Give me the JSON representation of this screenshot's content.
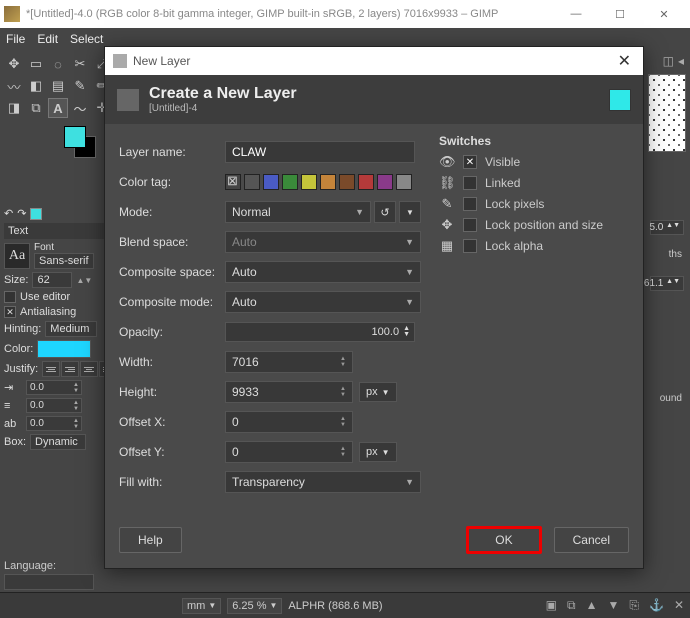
{
  "window": {
    "title": "*[Untitled]-4.0 (RGB color 8-bit gamma integer, GIMP built-in sRGB, 2 layers) 7016x9933 – GIMP"
  },
  "menu": {
    "file": "File",
    "edit": "Edit",
    "select": "Select"
  },
  "left": {
    "text_section": "Text",
    "font_label": "Font",
    "font_value": "Sans-serif",
    "size_label": "Size:",
    "size_value": "62",
    "use_editor": "Use editor",
    "antialiasing": "Antialiasing",
    "hinting_label": "Hinting:",
    "hinting_value": "Medium",
    "color_label": "Color:",
    "justify_label": "Justify:",
    "indent1": "0.0",
    "indent2": "0.0",
    "indent3": "0.0",
    "box_label": "Box:",
    "box_value": "Dynamic",
    "language_label": "Language:"
  },
  "dialog": {
    "title": "New Layer",
    "header_title": "Create a New Layer",
    "header_sub": "[Untitled]-4",
    "layer_name_label": "Layer name:",
    "layer_name_value": "CLAW",
    "color_tag_label": "Color tag:",
    "mode_label": "Mode:",
    "mode_value": "Normal",
    "blend_label": "Blend space:",
    "blend_value": "Auto",
    "comp_space_label": "Composite space:",
    "comp_space_value": "Auto",
    "comp_mode_label": "Composite mode:",
    "comp_mode_value": "Auto",
    "opacity_label": "Opacity:",
    "opacity_value": "100.0",
    "width_label": "Width:",
    "width_value": "7016",
    "height_label": "Height:",
    "height_value": "9933",
    "wh_unit": "px",
    "offx_label": "Offset X:",
    "offx_value": "0",
    "offy_label": "Offset Y:",
    "offy_value": "0",
    "off_unit": "px",
    "fill_label": "Fill with:",
    "fill_value": "Transparency",
    "switches_title": "Switches",
    "sw_visible": "Visible",
    "sw_linked": "Linked",
    "sw_lockpx": "Lock pixels",
    "sw_lockpos": "Lock position and size",
    "sw_lockalpha": "Lock alpha",
    "help": "Help",
    "ok": "OK",
    "cancel": "Cancel",
    "color_tags": [
      "#555",
      "#4a5bc4",
      "#3a8a3a",
      "#c4c43a",
      "#c4843a",
      "#7a4a2a",
      "#b43a3a",
      "#8a3a8a",
      "#888"
    ]
  },
  "right": {
    "val1": "5.0",
    "val2": "61.1",
    "ths": "ths",
    "ound": "ound"
  },
  "status": {
    "unit": "mm",
    "zoom": "6.25 %",
    "mem": "ALPHR (868.6 MB)"
  }
}
